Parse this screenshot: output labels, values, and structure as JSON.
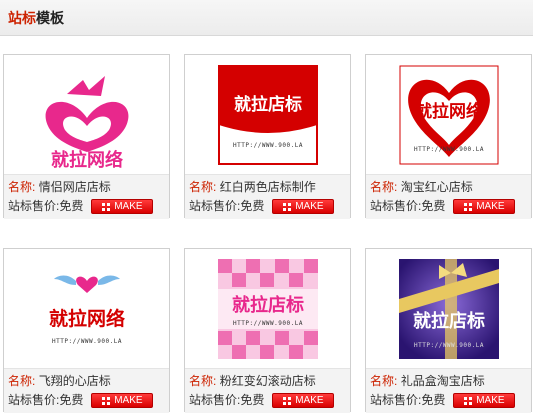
{
  "header": {
    "title_highlight": "站标",
    "title_rest": "模板"
  },
  "labels": {
    "name": "名称:",
    "price": "站标售价:",
    "make": "MAKE"
  },
  "items": [
    {
      "name": "情侣网店店标",
      "price": "免费",
      "logo_text": "就拉网络",
      "url": ""
    },
    {
      "name": "红白两色店标制作",
      "price": "免费",
      "logo_text": "就拉店标",
      "url": "HTTP://WWW.900.LA"
    },
    {
      "name": "淘宝红心店标",
      "price": "免费",
      "logo_text": "就拉网络",
      "url": "HTTP://WWW.900.LA"
    },
    {
      "name": "飞翔的心店标",
      "price": "免费",
      "logo_text": "就拉网络",
      "url": "HTTP://WWW.900.LA"
    },
    {
      "name": "粉红变幻滚动店标",
      "price": "免费",
      "logo_text": "就拉店标",
      "url": "HTTP://WWW.900.LA"
    },
    {
      "name": "礼品盒淘宝店标",
      "price": "免费",
      "logo_text": "就拉店标",
      "url": "HTTP://WWW.900.LA"
    }
  ],
  "colors": {
    "accent": "#cc2200",
    "button": "#e00000",
    "pink": "#e8288c"
  }
}
